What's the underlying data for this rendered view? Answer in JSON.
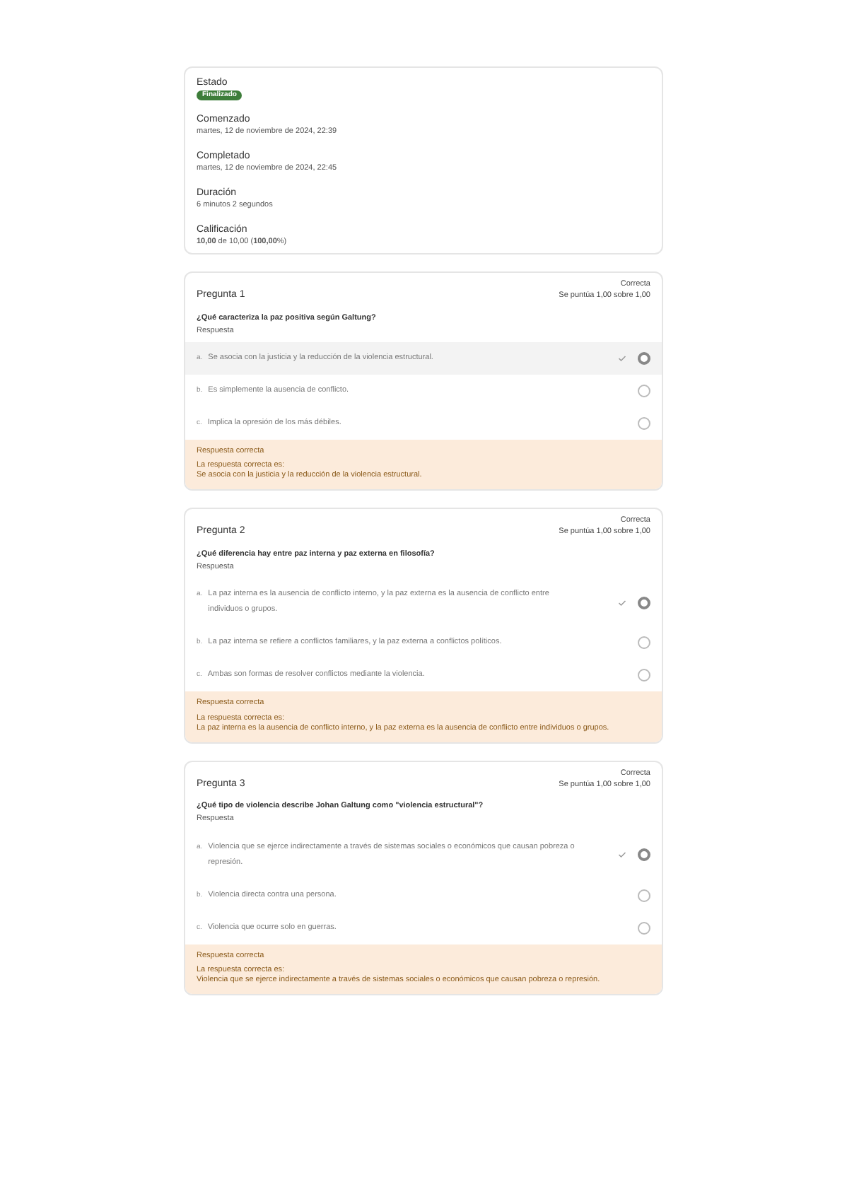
{
  "summary": [
    {
      "label": "Estado",
      "badge": "Finalizado"
    },
    {
      "label": "Comenzado",
      "value": "martes, 12 de noviembre de 2024, 22:39"
    },
    {
      "label": "Completado",
      "value": "martes, 12 de noviembre de 2024, 22:45"
    },
    {
      "label": "Duración",
      "value": "6 minutos 2 segundos"
    },
    {
      "label": "Calificación",
      "value": "**10,00** de 10,00 (**100,00**%)"
    }
  ],
  "questions": [
    {
      "title": "Pregunta 1",
      "status": "Correcta",
      "score": "Se puntúa 1,00 sobre 1,00",
      "text": "¿Qué caracteriza la paz positiva según Galtung?",
      "answer_label": "Respuesta",
      "options": [
        {
          "letter": "a.",
          "text": "Se asocia con la justicia y la reducción de la violencia estructural.",
          "selected": true,
          "correct": true,
          "highlighted": true
        },
        {
          "letter": "b.",
          "text": "Es simplemente la ausencia de conflicto.",
          "selected": false,
          "correct": false,
          "highlighted": false
        },
        {
          "letter": "c.",
          "text": "Implica la opresión de los más débiles.",
          "selected": false,
          "correct": false,
          "highlighted": false
        }
      ],
      "feedback": {
        "title": "Respuesta correcta",
        "intro": "La respuesta correcta es:",
        "answer": "Se asocia con la justicia y la reducción de la violencia estructural."
      }
    },
    {
      "title": "Pregunta 2",
      "status": "Correcta",
      "score": "Se puntúa 1,00 sobre 1,00",
      "text": "¿Qué diferencia hay entre paz interna y paz externa en filosofía?",
      "answer_label": "Respuesta",
      "options": [
        {
          "letter": "a.",
          "text": "La paz interna es la ausencia de conflicto interno, y la paz externa es la ausencia de conflicto entre individuos o grupos.",
          "selected": true,
          "correct": true,
          "highlighted": false
        },
        {
          "letter": "b.",
          "text": "La paz interna se refiere a conflictos familiares, y la paz externa a conflictos políticos.",
          "selected": false,
          "correct": false,
          "highlighted": false
        },
        {
          "letter": "c.",
          "text": "Ambas son formas de resolver conflictos mediante la violencia.",
          "selected": false,
          "correct": false,
          "highlighted": false
        }
      ],
      "feedback": {
        "title": "Respuesta correcta",
        "intro": "La respuesta correcta es:",
        "answer": "La paz interna es la ausencia de conflicto interno, y la paz externa es la ausencia de conflicto entre individuos o grupos."
      }
    },
    {
      "title": "Pregunta 3",
      "status": "Correcta",
      "score": "Se puntúa 1,00 sobre 1,00",
      "text": "¿Qué tipo de violencia describe Johan Galtung como \"violencia estructural\"?",
      "answer_label": "Respuesta",
      "options": [
        {
          "letter": "a.",
          "text": "Violencia que se ejerce indirectamente a través de sistemas sociales o económicos que causan pobreza o represión.",
          "selected": true,
          "correct": true,
          "highlighted": false
        },
        {
          "letter": "b.",
          "text": "Violencia directa contra una persona.",
          "selected": false,
          "correct": false,
          "highlighted": false
        },
        {
          "letter": "c.",
          "text": "Violencia que ocurre solo en guerras.",
          "selected": false,
          "correct": false,
          "highlighted": false
        }
      ],
      "feedback": {
        "title": "Respuesta correcta",
        "intro": "La respuesta correcta es:",
        "answer": "Violencia que se ejerce indirectamente a través de sistemas sociales o económicos que causan pobreza o represión."
      }
    }
  ]
}
